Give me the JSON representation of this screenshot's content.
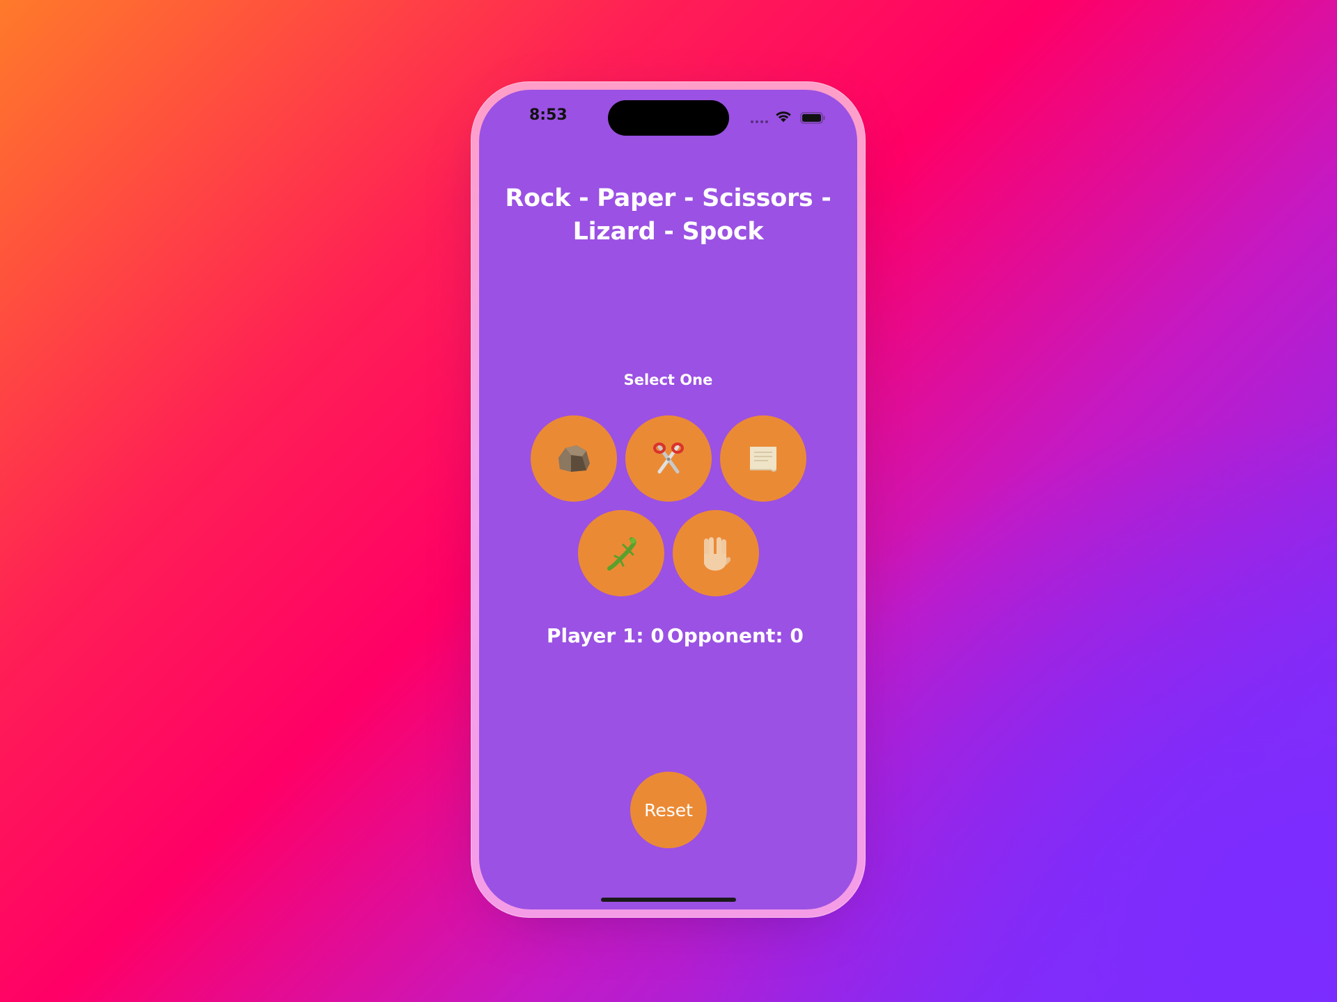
{
  "status_bar": {
    "time": "8:53"
  },
  "game": {
    "title": "Rock - Paper - Scissors - Lizard - Spock",
    "prompt": "Select One",
    "choices": [
      {
        "name": "Rock",
        "icon": "rock-icon"
      },
      {
        "name": "Scissors",
        "icon": "scissors-icon"
      },
      {
        "name": "Paper",
        "icon": "paper-icon"
      },
      {
        "name": "Lizard",
        "icon": "lizard-icon"
      },
      {
        "name": "Spock",
        "icon": "vulcan-salute-icon"
      }
    ],
    "score": {
      "player": "Player 1: 0",
      "opponent": "Opponent: 0"
    },
    "reset_label": "Reset"
  },
  "colors": {
    "screen_background": "#9b51e3",
    "button_fill": "#eb8a35",
    "text": "#ffffff"
  }
}
